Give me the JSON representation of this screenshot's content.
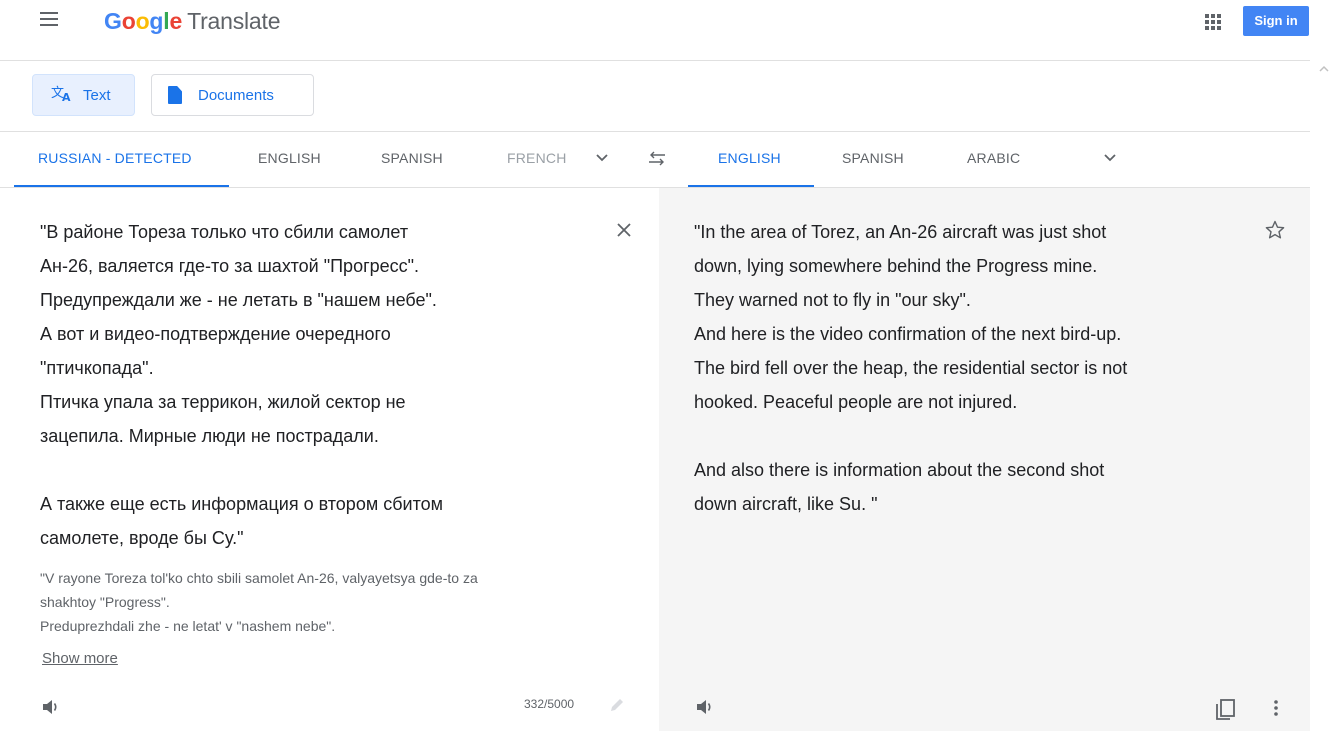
{
  "header": {
    "logo_google": [
      "G",
      "o",
      "o",
      "g",
      "l",
      "e"
    ],
    "logo_product": "Translate",
    "signin_label": "Sign in"
  },
  "modes": {
    "text_label": "Text",
    "documents_label": "Documents"
  },
  "source_langs": [
    "RUSSIAN - DETECTED",
    "ENGLISH",
    "SPANISH",
    "FRENCH"
  ],
  "target_langs": [
    "ENGLISH",
    "SPANISH",
    "ARABIC"
  ],
  "source": {
    "text": "\"В районе Тореза только что сбили самолет\nАн-26, валяется где-то за шахтой \"Прогресс\".\nПредупреждали же - не летать в \"нашем небе\".\nА вот и видео-подтверждение очередного\n\"птичкопада\".\nПтичка упала за террикон, жилой сектор не\nзацепила. Мирные люди не пострадали.\n\nА также еще есть информация о втором сбитом\nсамолете, вроде бы Су.\"",
    "transliteration": "\"V rayone Toreza tol'ko chto sbili samolet An-26, valyayetsya gde-to za\nshakhtoy \"Progress\".\nPreduprezhdali zhe - ne letat' v \"nashem nebe\".",
    "show_more": "Show more",
    "char_count": "332/5000"
  },
  "target": {
    "text": "\"In the area of Torez, an An-26 aircraft was just shot\ndown, lying somewhere behind the Progress mine.\nThey warned not to fly in \"our sky\".\nAnd here is the video confirmation of the next bird-up.\nThe bird fell over the heap, the residential sector is not\nhooked. Peaceful people are not injured.\n\nAnd also there is information about the second shot\ndown aircraft, like Su. \""
  },
  "icons": {
    "menu": "menu-icon",
    "apps": "apps-grid-icon",
    "translate": "translate-icon",
    "document": "document-icon",
    "swap": "swap-icon",
    "close": "close-icon",
    "star": "star-icon",
    "speaker": "speaker-icon",
    "edit": "pencil-icon",
    "copy": "copy-icon",
    "more": "more-vert-icon"
  },
  "colors": {
    "accent": "#1a73e8",
    "signin_bg": "#4285f4",
    "target_panel_bg": "#f5f5f5"
  }
}
